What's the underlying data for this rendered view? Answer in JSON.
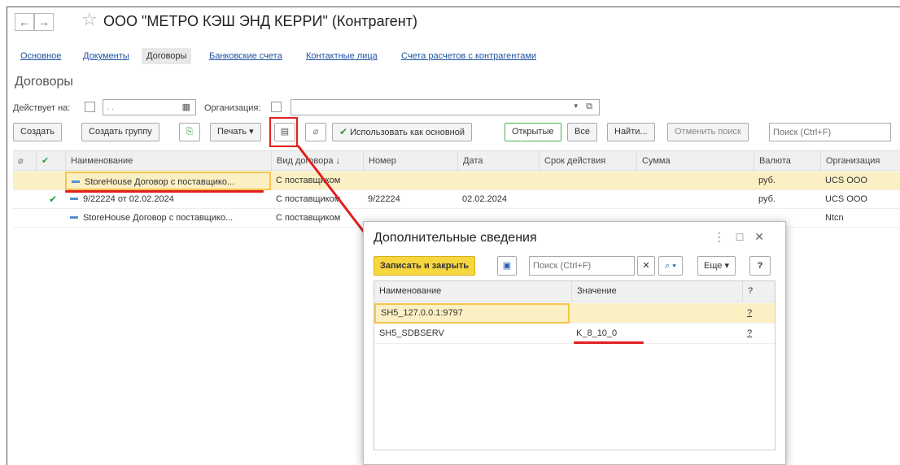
{
  "window": {
    "title": "ООО \"МЕТРО КЭШ ЭНД КЕРРИ\" (Контрагент)",
    "back": "←",
    "forward": "→"
  },
  "tabs": [
    "Основное",
    "Документы",
    "Договоры",
    "Банковские счета",
    "Контактные лица",
    "Счета расчетов с контрагентами"
  ],
  "section_title": "Договоры",
  "filters": {
    "active_on_label": "Действует на:",
    "date_placeholder": ". .",
    "org_label": "Организация:"
  },
  "toolbar": {
    "create": "Создать",
    "create_group": "Создать группу",
    "print": "Печать",
    "use_main": "Использовать как основной",
    "open": "Открытые",
    "all": "Все",
    "find": "Найти...",
    "cancel_search": "Отменить поиск",
    "search_placeholder": "Поиск (Ctrl+F)"
  },
  "table": {
    "columns": [
      "Наименование",
      "Вид договора ↓",
      "Номер",
      "Дата",
      "Срок действия",
      "Сумма",
      "Валюта",
      "Организация"
    ],
    "rows": [
      {
        "name": "StoreHouse Договор с поставщико...",
        "kind": "С поставщиком",
        "number": "",
        "date": "",
        "term": "",
        "sum": "",
        "currency": "руб.",
        "org": "UCS ООО",
        "checked": false,
        "selected": true
      },
      {
        "name": "9/22224 от 02.02.2024",
        "kind": "С поставщиком",
        "number": "9/22224",
        "date": "02.02.2024",
        "term": "",
        "sum": "",
        "currency": "руб.",
        "org": "UCS ООО",
        "checked": true,
        "selected": false
      },
      {
        "name": "StoreHouse Договор с поставщико...",
        "kind": "С поставщиком",
        "number": "",
        "date": "",
        "term": "",
        "sum": "",
        "currency": "",
        "org": "Ntcn",
        "checked": false,
        "selected": false
      }
    ]
  },
  "dialog": {
    "title": "Дополнительные сведения",
    "save_close": "Записать и закрыть",
    "search_placeholder": "Поиск (Ctrl+F)",
    "more": "Еще",
    "help": "?",
    "columns": [
      "Наименование",
      "Значение",
      "?"
    ],
    "rows": [
      {
        "name": "SH5_127.0.0.1:9797",
        "value": "",
        "q": "?"
      },
      {
        "name": "SH5_SDBSERV",
        "value": "K_8_10_0",
        "q": "?"
      }
    ]
  },
  "colors": {
    "accent": "#e02020",
    "selected_row": "#fbefc4",
    "primary_button": "#f7d740",
    "link": "#1e52a0"
  }
}
